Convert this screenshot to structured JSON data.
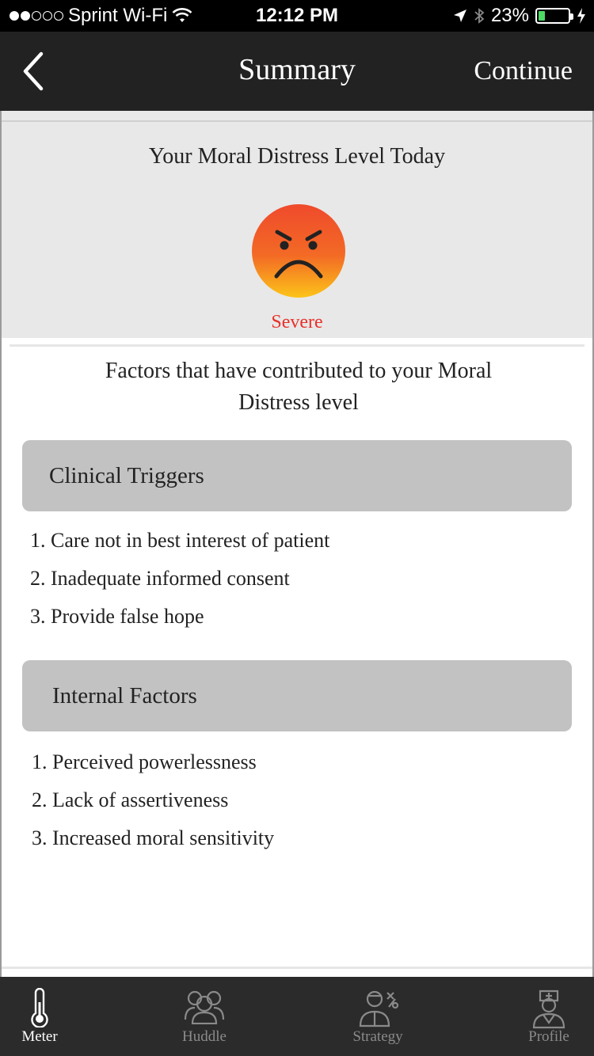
{
  "status_bar": {
    "carrier": "Sprint Wi-Fi",
    "time": "12:12 PM",
    "battery_percent": "23%",
    "battery_level": 0.23,
    "signal_bars": 2
  },
  "nav": {
    "title": "Summary",
    "continue_label": "Continue",
    "back_icon": "chevron-left-icon"
  },
  "summary": {
    "heading": "Your Moral Distress Level Today",
    "level_label": "Severe",
    "face_icon": "angry-face-icon",
    "level_color": "#e8302a"
  },
  "factors": {
    "heading_line1": "Factors that have contributed to your Moral",
    "heading_line2": "Distress level",
    "sections": [
      {
        "title": "Clinical Triggers",
        "items": [
          "1. Care not in best interest of patient",
          "2. Inadequate informed consent",
          "3. Provide false hope"
        ]
      },
      {
        "title": "Internal Factors",
        "items": [
          "1. Perceived powerlessness",
          "2. Lack of assertiveness",
          "3. Increased moral sensitivity"
        ]
      }
    ]
  },
  "tabs": [
    {
      "label": "Meter",
      "icon": "thermometer-icon",
      "active": true
    },
    {
      "label": "Huddle",
      "icon": "group-icon",
      "active": false
    },
    {
      "label": "Strategy",
      "icon": "strategy-person-icon",
      "active": false
    },
    {
      "label": "Profile",
      "icon": "nurse-profile-icon",
      "active": false
    }
  ]
}
